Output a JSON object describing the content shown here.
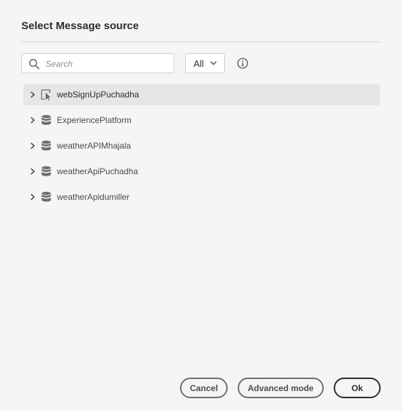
{
  "dialog": {
    "title": "Select Message source"
  },
  "search": {
    "placeholder": "Search",
    "value": "",
    "icon": "search-icon"
  },
  "filter": {
    "selected": "All",
    "icon": "chevron-down-icon"
  },
  "info": {
    "icon": "info-icon"
  },
  "tree": {
    "items": [
      {
        "label": "webSignUpPuchadha",
        "icon": "form-cursor-icon",
        "selected": true
      },
      {
        "label": "ExperiencePlatform",
        "icon": "database-icon",
        "selected": false
      },
      {
        "label": "weatherAPIMhajala",
        "icon": "database-icon",
        "selected": false
      },
      {
        "label": "weatherApiPuchadha",
        "icon": "database-icon",
        "selected": false
      },
      {
        "label": "weatherApidumiller",
        "icon": "database-icon",
        "selected": false
      }
    ]
  },
  "footer": {
    "cancel_label": "Cancel",
    "advanced_label": "Advanced mode",
    "ok_label": "Ok"
  },
  "colors": {
    "background": "#f5f5f5",
    "selected_row": "#e6e6e6",
    "text": "#2c2c2c",
    "icon": "#6e6e6e"
  }
}
